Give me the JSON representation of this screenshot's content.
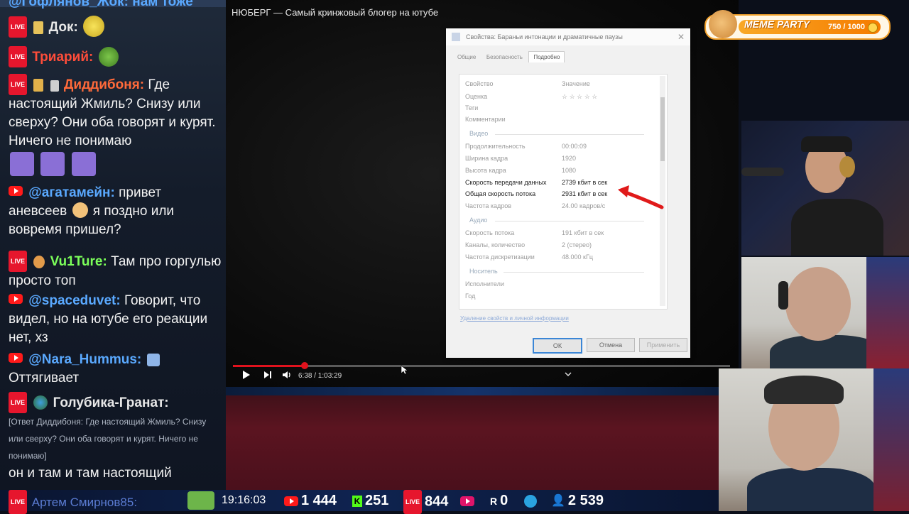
{
  "chat": {
    "messages": [
      {
        "badge": "LIVE",
        "nick": "Док:",
        "text": "",
        "nick_color": "#e8e8e8"
      },
      {
        "badge": "LIVE",
        "nick": "Триарий:",
        "text": "",
        "nick_color": "#ff4d3a"
      },
      {
        "badge": "LIVE",
        "nick": "Диддибоня:",
        "text": "Где настоящий Жмиль? Снизу или сверху? Они оба говорят и курят. Ничего не понимаю",
        "nick_color": "#ff6a3a"
      },
      {
        "badge": "YT",
        "nick": "@агатамейн:",
        "text": "привет аневсеев",
        "text2": "я поздно или вовремя пришел?",
        "nick_color": "#5aa9ff"
      },
      {
        "badge": "LIVE",
        "nick": "Vu1Ture:",
        "text": "Там про горгулью просто топ",
        "nick_color": "#7cff5a"
      },
      {
        "badge": "YT",
        "nick": "@spaceduvet:",
        "text": "Говорит, что видел, но на ютубе его реакции нет, хз",
        "nick_color": "#5aa9ff"
      },
      {
        "badge": "YT",
        "nick": "@Nara_Hummus:",
        "text": "Оттягивает",
        "nick_color": "#5aa9ff"
      },
      {
        "badge": "LIVE",
        "nick": "Голубика-Гранат:",
        "text": "он и там и там настоящий",
        "quote": "[Ответ Диддибоня: Где настоящий Жмиль? Снизу или сверху? Они оба говорят и курят. Ничего не понимаю]",
        "nick_color": "#e8e8e8"
      },
      {
        "badge": "LIVE",
        "nick": "Артем Смирнов85:",
        "text": "",
        "nick_color": "#5a7bd1"
      }
    ],
    "top_partial": "@Гофлянов_Жок: нам тоже"
  },
  "video": {
    "title": "НЮБЕРГ — Самый кринжовый блогер на ютубе",
    "time": "6:38 / 1:03:29",
    "progress": 0.144
  },
  "dialog": {
    "title": "Свойства: Бараньи интонации и драматичные паузы",
    "tabs": [
      "Общие",
      "Безопасность",
      "Подробно"
    ],
    "active_tab": "Подробно",
    "header_prop": "Свойство",
    "header_val": "Значение",
    "rows": [
      {
        "k": "Оценка",
        "v": "☆ ☆ ☆ ☆ ☆",
        "sharp": false
      },
      {
        "k": "Теги",
        "v": "",
        "sharp": false
      },
      {
        "k": "Комментарии",
        "v": "",
        "sharp": false
      },
      {
        "k": "Продолжительность",
        "v": "00:00:09",
        "sharp": false
      },
      {
        "k": "Ширина кадра",
        "v": "1920",
        "sharp": false
      },
      {
        "k": "Высота кадра",
        "v": "1080",
        "sharp": false
      },
      {
        "k": "Скорость передачи данных",
        "v": "2739 кбит в сек",
        "sharp": true
      },
      {
        "k": "Общая скорость потока",
        "v": "2931 кбит в сек",
        "sharp": true
      },
      {
        "k": "Частота кадров",
        "v": "24.00 кадров/с",
        "sharp": false
      },
      {
        "k": "Скорость потока",
        "v": "191 кбит в сек",
        "sharp": false
      },
      {
        "k": "Каналы, количество",
        "v": "2 (стерео)",
        "sharp": false
      },
      {
        "k": "Частота дискретизации",
        "v": "48.000 кГц",
        "sharp": false
      },
      {
        "k": "Исполнители",
        "v": "",
        "sharp": false
      },
      {
        "k": "Год",
        "v": "",
        "sharp": false
      }
    ],
    "sections": [
      "Видео",
      "Аудио",
      "Носитель"
    ],
    "link": "Удаление свойств и личной информации",
    "buttons": [
      "ОК",
      "Отмена",
      "Применить"
    ]
  },
  "meme_party": {
    "title": "MEME PARTY",
    "count": "750 / 1000"
  },
  "status": {
    "time": "19:16:03",
    "youtube": "1 444",
    "kick": "251",
    "vk": "844",
    "rutube_like": "",
    "r": "0",
    "telegram": "",
    "viewers": "2 539"
  },
  "colors": {
    "accent_red": "#e0121d",
    "meme_orange": "#f57c00"
  }
}
